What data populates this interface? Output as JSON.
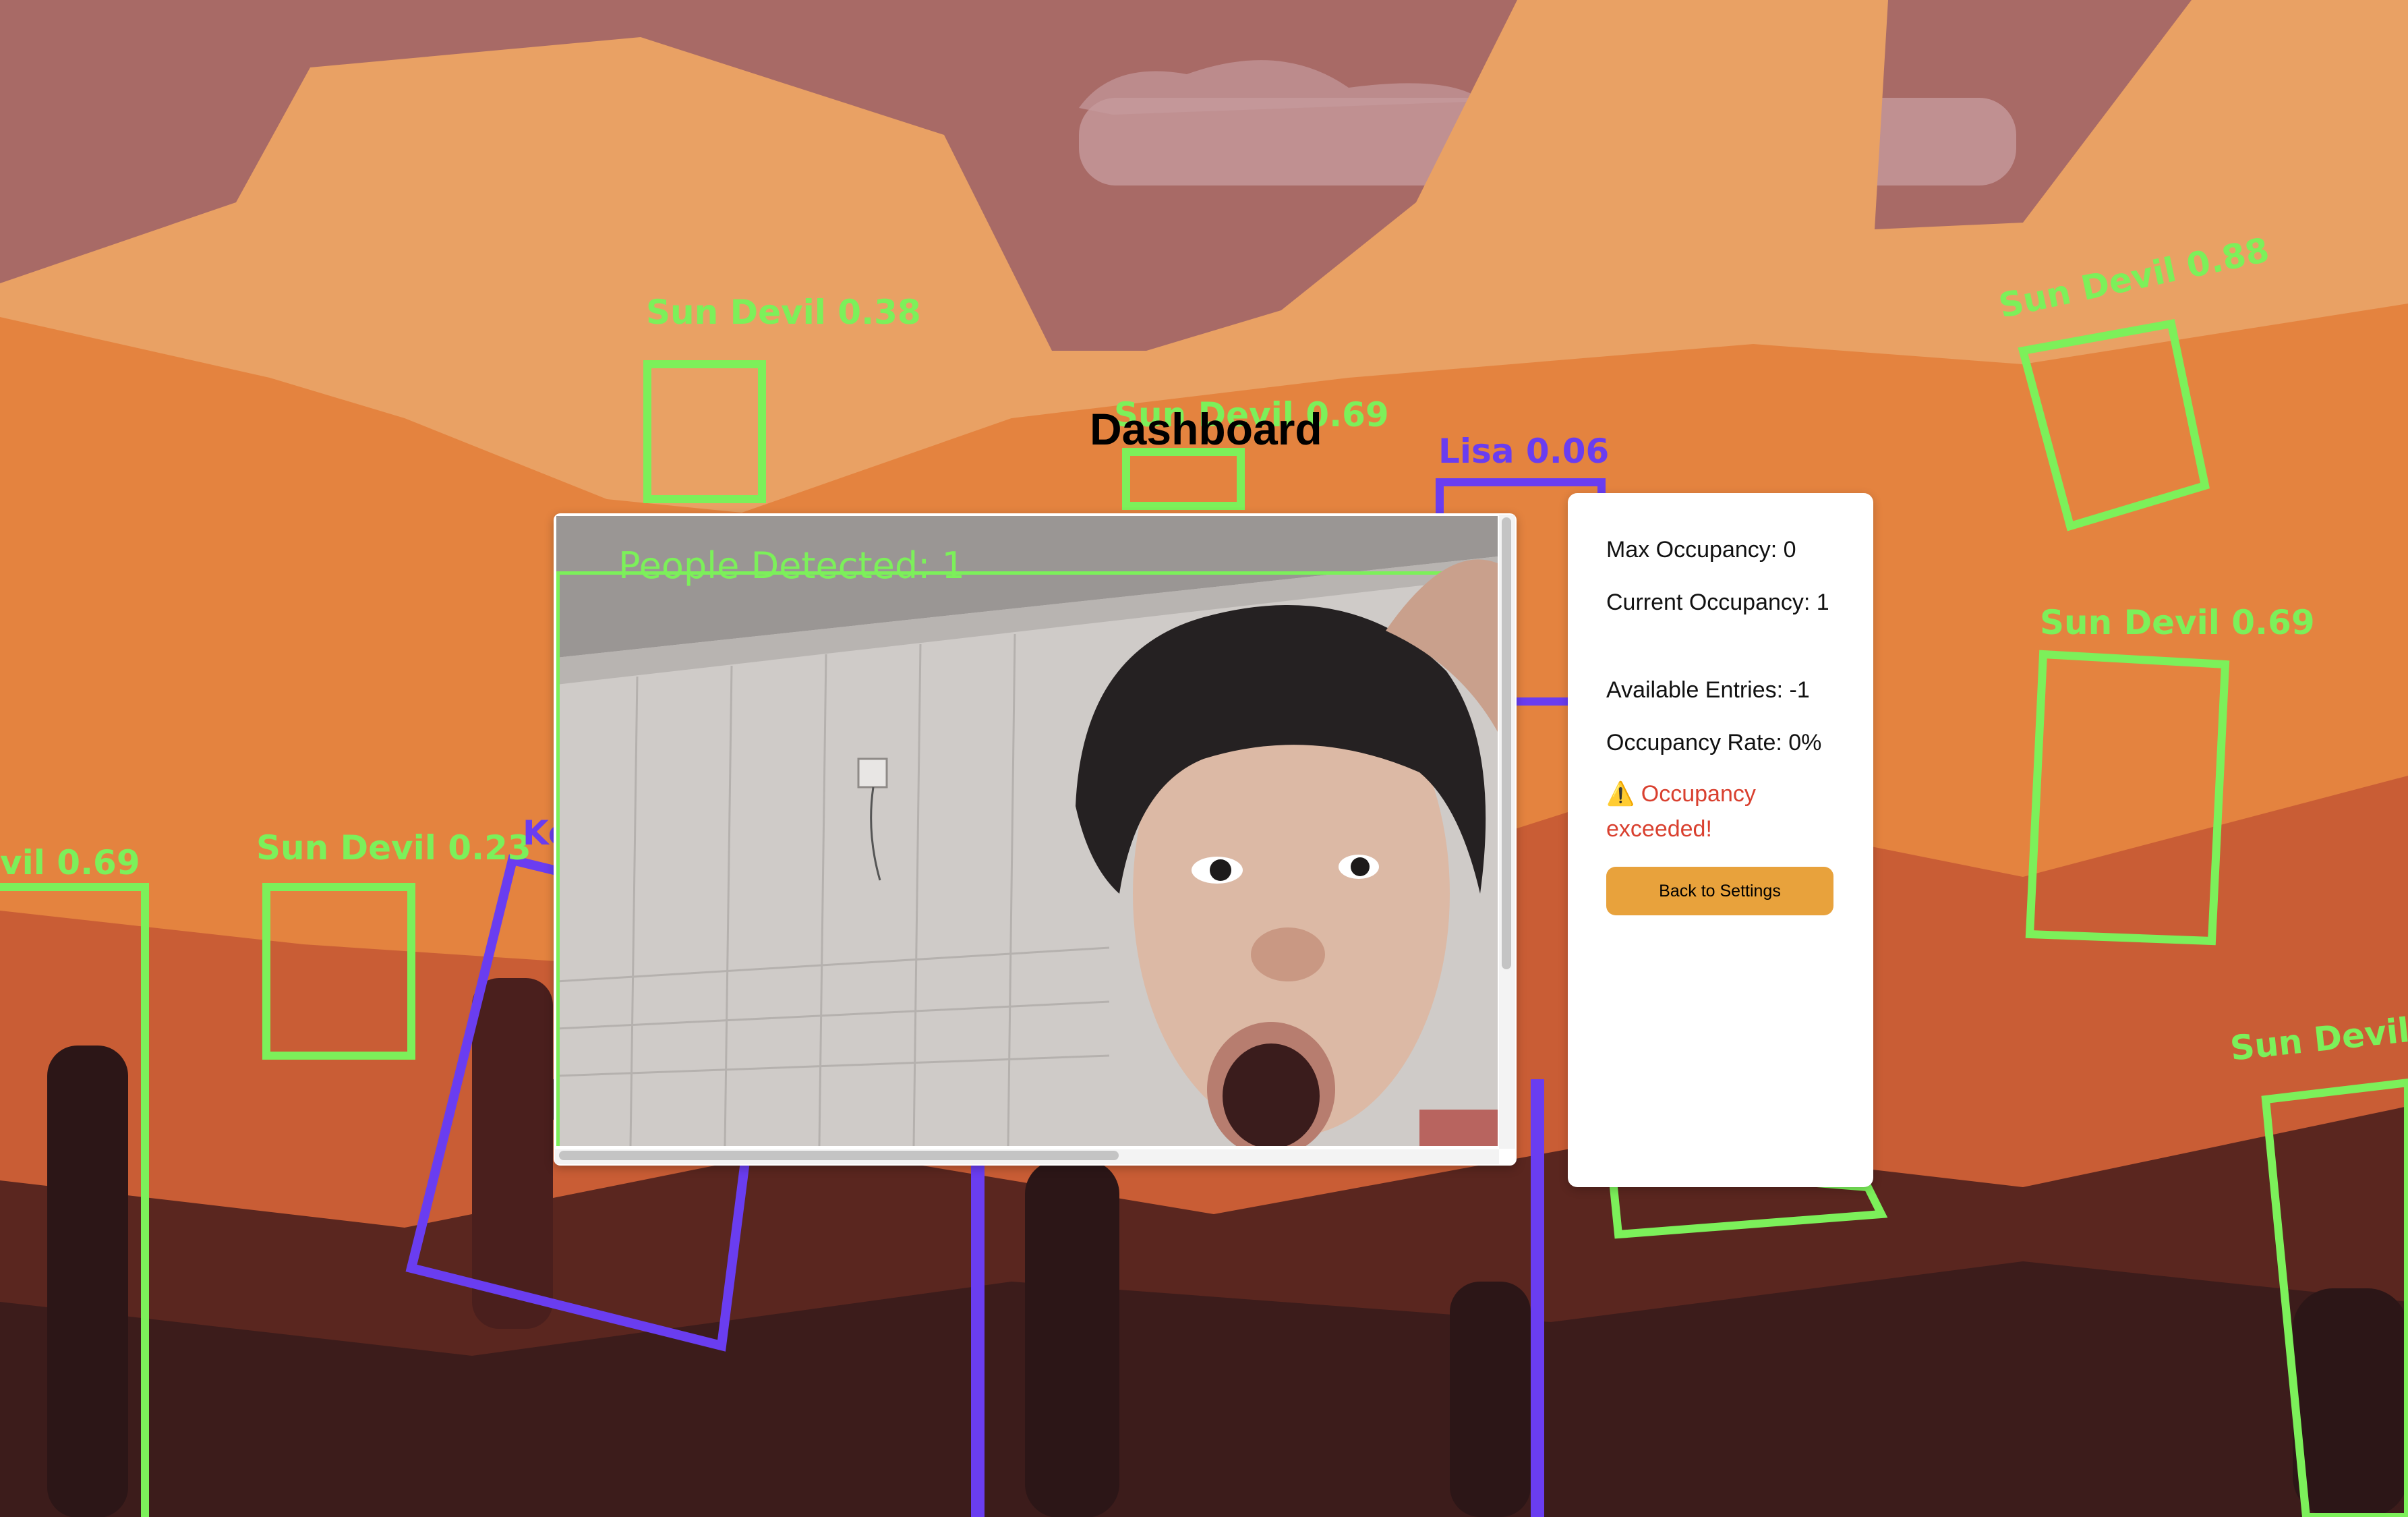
{
  "page": {
    "title": "Dashboard"
  },
  "background_detections": [
    {
      "label": "Sun Devil 0.38",
      "color": "#7cf05a"
    },
    {
      "label": "Sun Devil 0.69",
      "color": "#7cf05a"
    },
    {
      "label": "Lisa 0.06",
      "color": "#6a3df0"
    },
    {
      "label": "Sun Devil 0.88",
      "color": "#7cf05a"
    },
    {
      "label": "Sun Devil 0.69",
      "color": "#7cf05a"
    },
    {
      "label": "vil 0.69",
      "color": "#7cf05a"
    },
    {
      "label": "Sun Devil 0.23",
      "color": "#7cf05a"
    },
    {
      "label": "Ke",
      "color": "#6a3df0"
    },
    {
      "label": "Sun Devil",
      "color": "#7cf05a"
    }
  ],
  "video": {
    "overlay_text": "People Detected:  1",
    "overlay_color": "#7cf05a"
  },
  "stats": {
    "max_occupancy": "Max Occupancy: 0",
    "current_occupancy": "Current Occupancy: 1",
    "available_entries": "Available Entries: -1",
    "occupancy_rate": "Occupancy Rate: 0%",
    "warning_icon": "warning-icon",
    "warning_text": "Occupancy exceeded!",
    "warning_color": "#d9402f"
  },
  "buttons": {
    "back_label": "Back to Settings",
    "back_color": "#e8a23c"
  }
}
